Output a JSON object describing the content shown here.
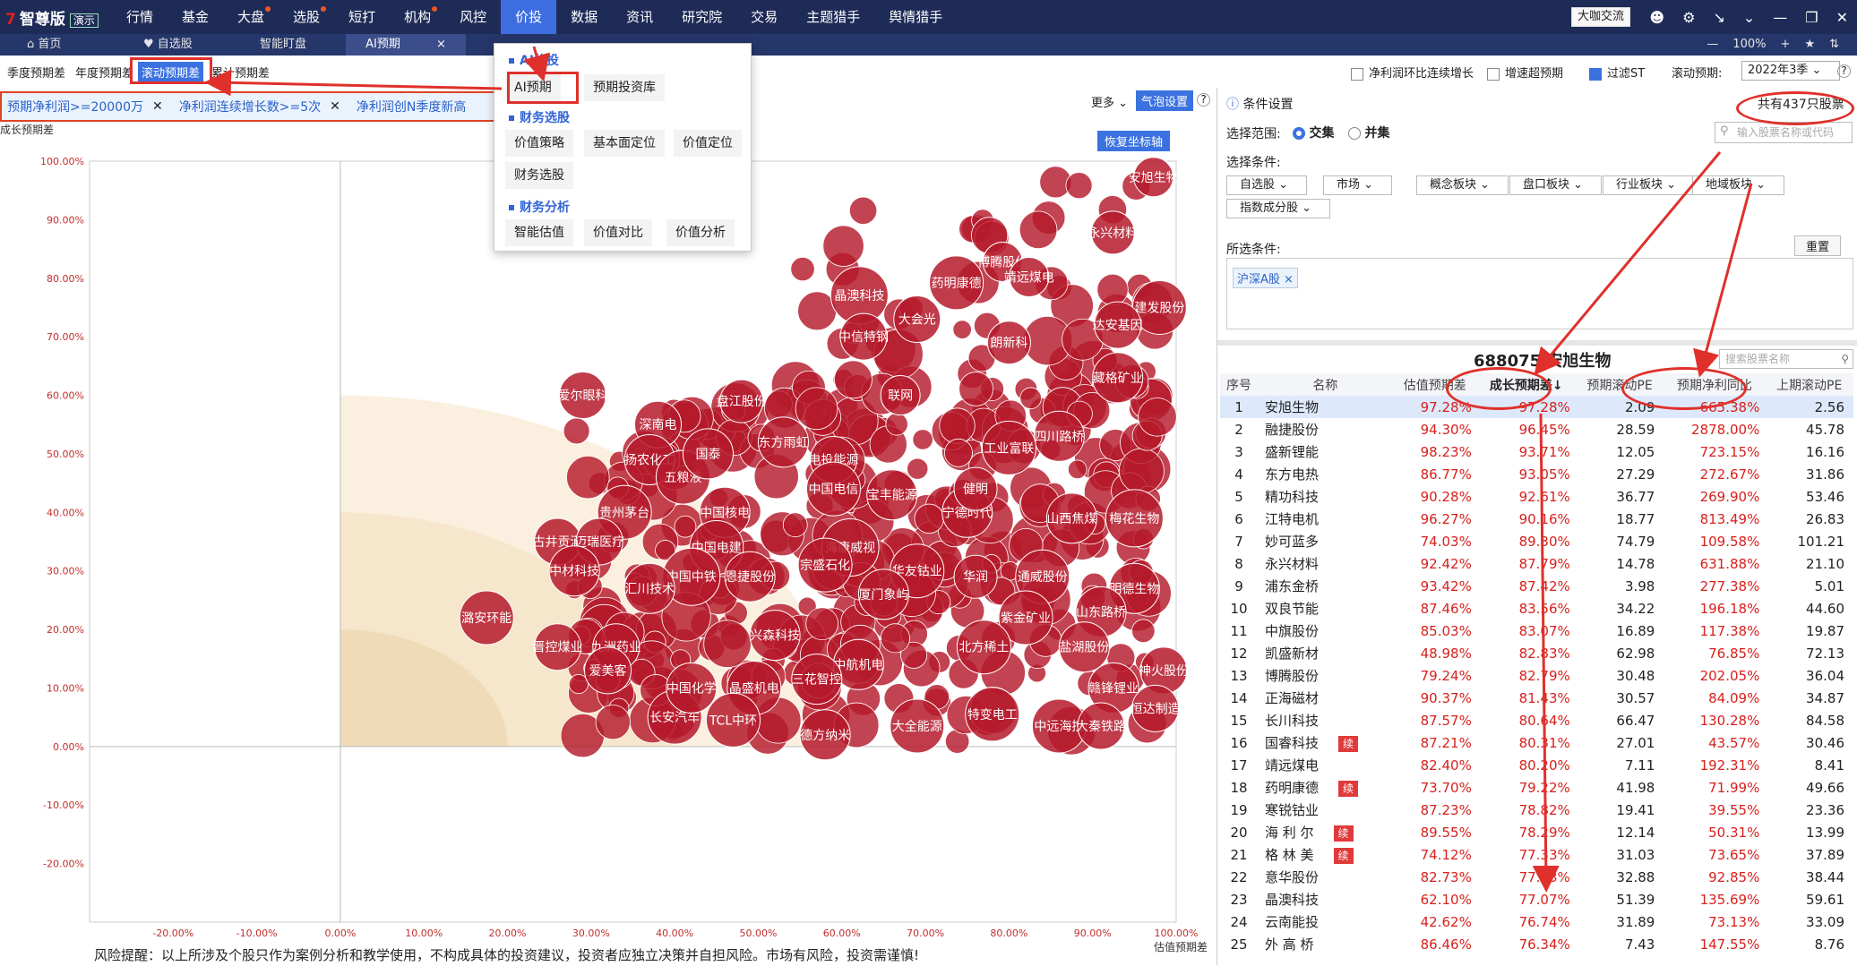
{
  "app": {
    "logo": "智尊版",
    "demo": "演示"
  },
  "nav": [
    {
      "label": "行情",
      "dot": false
    },
    {
      "label": "基金",
      "dot": false
    },
    {
      "label": "大盘",
      "dot": true
    },
    {
      "label": "选股",
      "dot": true
    },
    {
      "label": "短打",
      "dot": false
    },
    {
      "label": "机构",
      "dot": true
    },
    {
      "label": "风控",
      "dot": false
    },
    {
      "label": "价投",
      "dot": false,
      "active": true
    },
    {
      "label": "数据",
      "dot": false
    },
    {
      "label": "资讯",
      "dot": false
    },
    {
      "label": "研究院",
      "dot": false
    },
    {
      "label": "交易",
      "dot": false
    },
    {
      "label": "主题猎手",
      "dot": false
    },
    {
      "label": "舆情猎手",
      "dot": false
    }
  ],
  "bigshot": "大咖交流",
  "tabs": {
    "home": "首页",
    "fav": "自选股",
    "smart": "智能盯盘",
    "ai": "AI预期",
    "close": "×",
    "zoom": "100%"
  },
  "filter_tabs": [
    "季度预期差",
    "年度预期差",
    "滚动预期差",
    "累计预期差"
  ],
  "conditions": [
    "预期净利润>=20000万",
    "净利润连续增长数>=5次",
    "净利润创N季度新高"
  ],
  "chart_controls": {
    "more": "更多",
    "bubble": "气泡设置",
    "reset": "恢复坐标轴"
  },
  "dropdown": {
    "sections": [
      {
        "title": "AI价投",
        "items": [
          "AI预期",
          "预期投资库"
        ]
      },
      {
        "title": "财务选股",
        "items": [
          "价值策略",
          "基本面定位",
          "价值定位",
          "财务选股"
        ]
      },
      {
        "title": "财务分析",
        "items": [
          "智能估值",
          "价值对比",
          "价值分析"
        ]
      }
    ]
  },
  "right_top": {
    "c1": "净利润环比连续增长",
    "c2": "增速超预期",
    "c3": "过滤ST",
    "roll_label": "滚动预期:",
    "roll_value": "2022年3季"
  },
  "conds_panel": {
    "title": "条件设置",
    "total": "共有437只股票",
    "scope_label": "选择范围:",
    "scope_a": "交集",
    "scope_b": "并集",
    "search_ph": "输入股票名称或代码",
    "choose_label": "选择条件:",
    "dropdowns": [
      "自选股",
      "市场",
      "概念板块",
      "盘口板块",
      "行业板块",
      "地域板块",
      "指数成分股"
    ],
    "selected_label": "所选条件:",
    "reset": "重置",
    "tag": "沪深A股"
  },
  "stock_head": {
    "code": "688075",
    "name": "安旭生物",
    "search_ph": "搜索股票名称"
  },
  "table": {
    "headers": [
      "序号",
      "名称",
      "估值预期差",
      "成长预期差↓",
      "预期滚动PE",
      "预期净利同比",
      "上期滚动PE"
    ],
    "rows": [
      [
        "1",
        "安旭生物",
        "",
        "97.28%",
        "97.28%",
        "2.09",
        "665.38%",
        "2.56"
      ],
      [
        "2",
        "融捷股份",
        "",
        "94.30%",
        "96.45%",
        "28.59",
        "2878.00%",
        "45.78"
      ],
      [
        "3",
        "盛新锂能",
        "",
        "98.23%",
        "93.71%",
        "12.05",
        "723.15%",
        "16.16"
      ],
      [
        "4",
        "东方电热",
        "",
        "86.77%",
        "93.05%",
        "27.29",
        "272.67%",
        "31.86"
      ],
      [
        "5",
        "精功科技",
        "",
        "90.28%",
        "92.61%",
        "36.77",
        "269.90%",
        "53.46"
      ],
      [
        "6",
        "江特电机",
        "",
        "96.27%",
        "90.16%",
        "18.77",
        "813.49%",
        "26.83"
      ],
      [
        "7",
        "妙可蓝多",
        "",
        "74.03%",
        "89.30%",
        "74.79",
        "109.58%",
        "101.21"
      ],
      [
        "8",
        "永兴材料",
        "",
        "92.42%",
        "87.79%",
        "14.78",
        "631.88%",
        "21.10"
      ],
      [
        "9",
        "浦东金桥",
        "",
        "93.42%",
        "87.42%",
        "3.98",
        "277.38%",
        "5.01"
      ],
      [
        "10",
        "双良节能",
        "",
        "87.46%",
        "83.56%",
        "34.22",
        "196.18%",
        "44.60"
      ],
      [
        "11",
        "中旗股份",
        "",
        "85.03%",
        "83.07%",
        "16.89",
        "117.38%",
        "19.87"
      ],
      [
        "12",
        "凯盛新材",
        "",
        "48.98%",
        "82.83%",
        "62.98",
        "76.85%",
        "72.13"
      ],
      [
        "13",
        "博腾股份",
        "",
        "79.24%",
        "82.79%",
        "30.48",
        "202.05%",
        "36.04"
      ],
      [
        "14",
        "正海磁材",
        "",
        "90.37%",
        "81.43%",
        "30.57",
        "84.09%",
        "34.87"
      ],
      [
        "15",
        "长川科技",
        "",
        "87.57%",
        "80.64%",
        "66.47",
        "130.28%",
        "84.58"
      ],
      [
        "16",
        "国睿科技",
        "续",
        "87.21%",
        "80.31%",
        "27.01",
        "43.57%",
        "30.46"
      ],
      [
        "17",
        "靖远煤电",
        "",
        "82.40%",
        "80.20%",
        "7.11",
        "192.31%",
        "8.41"
      ],
      [
        "18",
        "药明康德",
        "续",
        "73.70%",
        "79.22%",
        "41.98",
        "71.99%",
        "49.66"
      ],
      [
        "19",
        "寒锐钴业",
        "",
        "87.23%",
        "78.82%",
        "19.41",
        "39.55%",
        "23.36"
      ],
      [
        "20",
        "海 利 尔",
        "续",
        "89.55%",
        "78.29%",
        "12.14",
        "50.31%",
        "13.99"
      ],
      [
        "21",
        "格 林 美",
        "续",
        "74.12%",
        "77.33%",
        "31.03",
        "73.65%",
        "37.89"
      ],
      [
        "22",
        "意华股份",
        "",
        "82.73%",
        "77.33%",
        "32.88",
        "92.85%",
        "38.44"
      ],
      [
        "23",
        "晶澳科技",
        "",
        "62.10%",
        "77.07%",
        "51.39",
        "135.69%",
        "59.61"
      ],
      [
        "24",
        "云南能投",
        "",
        "42.62%",
        "76.74%",
        "31.89",
        "73.13%",
        "33.09"
      ],
      [
        "25",
        "外 高 桥",
        "",
        "86.46%",
        "76.34%",
        "7.43",
        "147.55%",
        "8.76"
      ]
    ]
  },
  "chart_data": {
    "type": "scatter",
    "ylabel": "成长预期差",
    "xlabel": "估值预期差",
    "xlim": [
      -0.3,
      1.0
    ],
    "ylim": [
      -0.3,
      1.0
    ],
    "xticks": [
      "-20.00%",
      "-10.00%",
      "0.00%",
      "10.00%",
      "20.00%",
      "30.00%",
      "40.00%",
      "50.00%",
      "60.00%",
      "70.00%",
      "80.00%",
      "90.00%",
      "100.00%"
    ],
    "yticks": [
      "100.00%",
      "90.00%",
      "80.00%",
      "70.00%",
      "60.00%",
      "50.00%",
      "40.00%",
      "30.00%",
      "20.00%",
      "10.00%",
      "0.00%",
      "-10.00%",
      "-20.00%"
    ],
    "labeled_points": [
      {
        "name": "安旭生物",
        "x": 0.9728,
        "y": 0.9728,
        "size": 22
      },
      {
        "name": "永兴材料",
        "x": 0.9242,
        "y": 0.8779,
        "size": 24
      },
      {
        "name": "建发股份",
        "x": 0.98,
        "y": 0.75,
        "size": 30
      },
      {
        "name": "达安基因",
        "x": 0.93,
        "y": 0.72,
        "size": 26
      },
      {
        "name": "晶澳科技",
        "x": 0.621,
        "y": 0.7707,
        "size": 32
      },
      {
        "name": "药明康德",
        "x": 0.737,
        "y": 0.7922,
        "size": 30
      },
      {
        "name": "博腾股份",
        "x": 0.7924,
        "y": 0.8279,
        "size": 22
      },
      {
        "name": "靖远煤电",
        "x": 0.824,
        "y": 0.802,
        "size": 22
      },
      {
        "name": "大会光",
        "x": 0.69,
        "y": 0.73,
        "size": 26
      },
      {
        "name": "中信特钢",
        "x": 0.626,
        "y": 0.7,
        "size": 26
      },
      {
        "name": "朗新科",
        "x": 0.8,
        "y": 0.69,
        "size": 24
      },
      {
        "name": "藏格矿业",
        "x": 0.93,
        "y": 0.63,
        "size": 28
      },
      {
        "name": "爱尔眼科",
        "x": 0.29,
        "y": 0.6,
        "size": 26
      },
      {
        "name": "盘江股份",
        "x": 0.48,
        "y": 0.59,
        "size": 24
      },
      {
        "name": "联网",
        "x": 0.67,
        "y": 0.6,
        "size": 22
      },
      {
        "name": "深南电",
        "x": 0.38,
        "y": 0.55,
        "size": 26
      },
      {
        "name": "东方雨虹",
        "x": 0.53,
        "y": 0.52,
        "size": 28
      },
      {
        "name": "四川路桥",
        "x": 0.86,
        "y": 0.53,
        "size": 28
      },
      {
        "name": "工业富联",
        "x": 0.8,
        "y": 0.51,
        "size": 30
      },
      {
        "name": "电投能源",
        "x": 0.59,
        "y": 0.49,
        "size": 26
      },
      {
        "name": "扬农化工",
        "x": 0.37,
        "y": 0.49,
        "size": 28
      },
      {
        "name": "五粮液",
        "x": 0.41,
        "y": 0.46,
        "size": 30
      },
      {
        "name": "海康威视",
        "x": 0.61,
        "y": 0.34,
        "size": 32
      },
      {
        "name": "宝丰能源",
        "x": 0.66,
        "y": 0.43,
        "size": 28
      },
      {
        "name": "中国电信",
        "x": 0.59,
        "y": 0.44,
        "size": 30
      },
      {
        "name": "中国核电",
        "x": 0.46,
        "y": 0.4,
        "size": 28
      },
      {
        "name": "贵州茅台",
        "x": 0.34,
        "y": 0.4,
        "size": 30
      },
      {
        "name": "山西焦煤",
        "x": 0.875,
        "y": 0.39,
        "size": 28
      },
      {
        "name": "梅花生物",
        "x": 0.95,
        "y": 0.39,
        "size": 32
      },
      {
        "name": "古井贡酒",
        "x": 0.26,
        "y": 0.35,
        "size": 26
      },
      {
        "name": "迈瑞医疗",
        "x": 0.31,
        "y": 0.35,
        "size": 26
      },
      {
        "name": "中国电建",
        "x": 0.45,
        "y": 0.34,
        "size": 30
      },
      {
        "name": "中材科技",
        "x": 0.28,
        "y": 0.3,
        "size": 28
      },
      {
        "name": "中国中铁",
        "x": 0.42,
        "y": 0.29,
        "size": 32
      },
      {
        "name": "恩捷股份",
        "x": 0.49,
        "y": 0.29,
        "size": 28
      },
      {
        "name": "宗盛石化",
        "x": 0.58,
        "y": 0.31,
        "size": 30
      },
      {
        "name": "华友钴业",
        "x": 0.69,
        "y": 0.3,
        "size": 30
      },
      {
        "name": "通威股份",
        "x": 0.84,
        "y": 0.29,
        "size": 30
      },
      {
        "name": "明德生物",
        "x": 0.95,
        "y": 0.27,
        "size": 28
      },
      {
        "name": "潞安环能",
        "x": 0.175,
        "y": 0.22,
        "size": 30
      },
      {
        "name": "晋控煤业",
        "x": 0.26,
        "y": 0.17,
        "size": 26
      },
      {
        "name": "九洲药业",
        "x": 0.33,
        "y": 0.17,
        "size": 26
      },
      {
        "name": "紫金矿业",
        "x": 0.82,
        "y": 0.22,
        "size": 30
      },
      {
        "name": "山东路桥",
        "x": 0.91,
        "y": 0.23,
        "size": 28
      },
      {
        "name": "北方稀土",
        "x": 0.77,
        "y": 0.17,
        "size": 30
      },
      {
        "name": "盐湖股份",
        "x": 0.89,
        "y": 0.17,
        "size": 28
      },
      {
        "name": "兴森科技",
        "x": 0.52,
        "y": 0.19,
        "size": 28
      },
      {
        "name": "中航机电",
        "x": 0.62,
        "y": 0.14,
        "size": 28
      },
      {
        "name": "晶盛机电",
        "x": 0.495,
        "y": 0.1,
        "size": 30
      },
      {
        "name": "三花智控",
        "x": 0.57,
        "y": 0.115,
        "size": 28
      },
      {
        "name": "赣锋锂业",
        "x": 0.925,
        "y": 0.1,
        "size": 28
      },
      {
        "name": "神火股份",
        "x": 0.985,
        "y": 0.13,
        "size": 26
      },
      {
        "name": "恒达制造",
        "x": 0.975,
        "y": 0.065,
        "size": 26
      },
      {
        "name": "长安汽车",
        "x": 0.4,
        "y": 0.05,
        "size": 30
      },
      {
        "name": "TCL中环",
        "x": 0.47,
        "y": 0.045,
        "size": 30
      },
      {
        "name": "德方纳米",
        "x": 0.58,
        "y": 0.02,
        "size": 28
      },
      {
        "name": "大全能源",
        "x": 0.69,
        "y": 0.035,
        "size": 30
      },
      {
        "name": "特变电工",
        "x": 0.78,
        "y": 0.055,
        "size": 30
      },
      {
        "name": "中远海控",
        "x": 0.86,
        "y": 0.035,
        "size": 30
      },
      {
        "name": "大秦铁路",
        "x": 0.91,
        "y": 0.035,
        "size": 26
      },
      {
        "name": "爱美客",
        "x": 0.32,
        "y": 0.13,
        "size": 26
      },
      {
        "name": "汇川技术",
        "x": 0.37,
        "y": 0.27,
        "size": 28
      },
      {
        "name": "国泰",
        "x": 0.44,
        "y": 0.5,
        "size": 28
      },
      {
        "name": "中国化学",
        "x": 0.42,
        "y": 0.1,
        "size": 28
      },
      {
        "name": "厦门象屿",
        "x": 0.65,
        "y": 0.26,
        "size": 28
      },
      {
        "name": "宁德时代",
        "x": 0.75,
        "y": 0.4,
        "size": 28
      },
      {
        "name": "健明",
        "x": 0.76,
        "y": 0.44,
        "size": 24
      },
      {
        "name": "华润",
        "x": 0.76,
        "y": 0.29,
        "size": 24
      }
    ]
  }
}
